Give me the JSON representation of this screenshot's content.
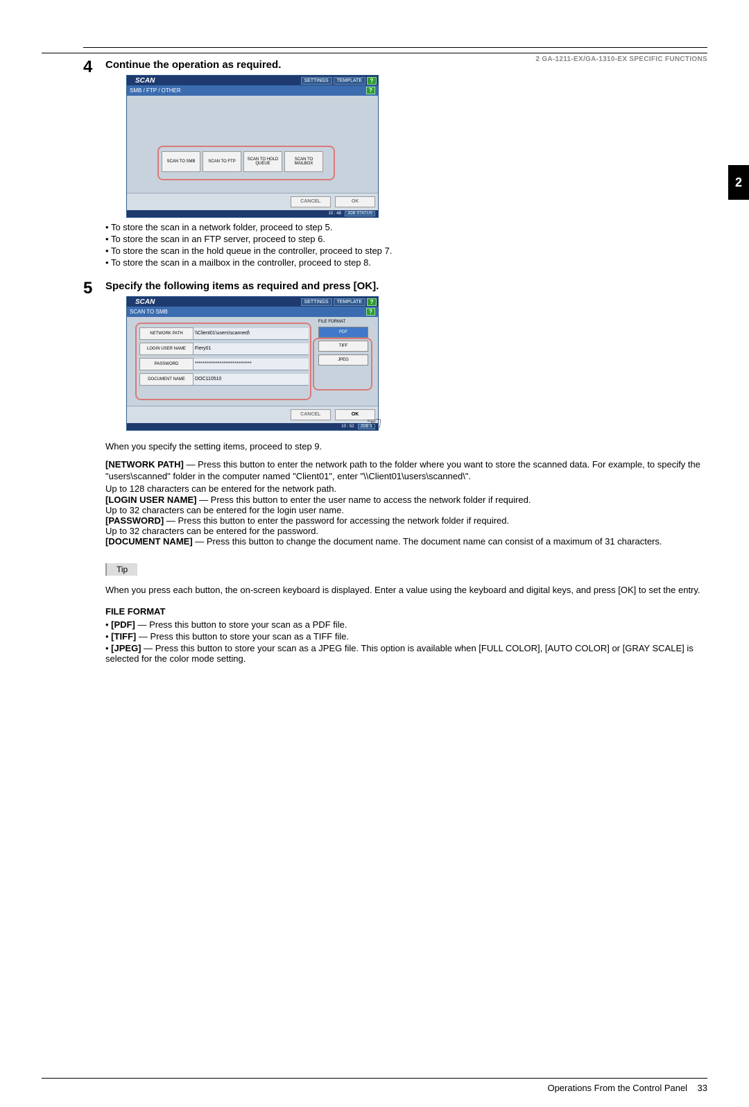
{
  "header": {
    "section": "2 GA-1211-EX/GA-1310-EX SPECIFIC FUNCTIONS",
    "tab": "2"
  },
  "step4": {
    "num": "4",
    "title": "Continue the operation as required.",
    "bullets": [
      "To store the scan in a network folder, proceed to step 5.",
      "To store the scan in an FTP server, proceed to step 6.",
      "To store the scan in the hold queue in the controller, proceed to step 7.",
      "To store the scan in a mailbox in the controller, proceed to step 8."
    ],
    "panel": {
      "title": "SCAN",
      "settings": "SETTINGS",
      "template": "TEMPLATE",
      "help": "?",
      "breadcrumb": "SMB / FTP / OTHER",
      "dest": [
        "SCAN TO SMB",
        "SCAN TO FTP",
        "SCAN TO HOLD QUEUE",
        "SCAN TO MAILBOX"
      ],
      "cancel": "CANCEL",
      "ok": "OK",
      "time": "10 : 48",
      "jobstatus": "JOB STATUS"
    }
  },
  "step5": {
    "num": "5",
    "title": "Specify the following items as required and press [OK].",
    "panel": {
      "title": "SCAN",
      "settings": "SETTINGS",
      "template": "TEMPLATE",
      "help": "?",
      "breadcrumb": "SCAN TO SMB",
      "rows": {
        "network_path_label": "NETWORK PATH",
        "network_path_value": "\\\\Client01\\users\\scanned\\",
        "login_label": "LOGIN USER NAME",
        "login_value": "Fiery01",
        "password_label": "PASSWORD",
        "password_value": "******************************",
        "docname_label": "DOCUMENT NAME",
        "docname_value": "DOC110510"
      },
      "ff_title": "FILE FORMAT",
      "ff": {
        "pdf": "PDF",
        "tiff": "TIFF",
        "jpeg": "JPEG"
      },
      "cancel": "CANCEL",
      "ok": "OK",
      "time": "10 : 52",
      "jobstatus": "JOB S"
    },
    "after": "When you specify the setting items, proceed to step 9.",
    "np_h": "[NETWORK PATH]",
    "np_t": " — Press this button to enter the network path to the folder where you want to store the scanned data. For example, to specify the \"users\\scanned\" folder in the computer named \"Client01\", enter \"\\\\Client01\\users\\scanned\\\".",
    "np_t2": "Up to 128 characters can be entered for the network path.",
    "lu_h": "[LOGIN USER NAME]",
    "lu_t": " — Press this button to enter the user name to access the network folder if required.",
    "lu_t2": "Up to 32 characters can be entered for the login user name.",
    "pw_h": "[PASSWORD]",
    "pw_t": " — Press this button to enter the password for accessing the network folder if required.",
    "pw_t2": "Up to 32 characters can be entered for the password.",
    "dn_h": "[DOCUMENT NAME]",
    "dn_t": " — Press this button to change the document name. The document name can consist of a maximum of 31 characters.",
    "tip_label": "Tip",
    "tip_text": "When you press each button, the on-screen keyboard is displayed. Enter a value using the keyboard and digital keys, and press [OK] to set the entry.",
    "ff_head": "FILE FORMAT",
    "ff_pdf_h": "[PDF]",
    "ff_pdf_t": " — Press this button to store your scan as a PDF file.",
    "ff_tiff_h": "[TIFF]",
    "ff_tiff_t": " — Press this button to store your scan as a TIFF file.",
    "ff_jpeg_h": "[JPEG]",
    "ff_jpeg_t": " — Press this button to store your scan as a JPEG file. This option is available when [FULL COLOR], [AUTO COLOR] or [GRAY SCALE] is selected for the color mode setting."
  },
  "footer": {
    "text": "Operations From the Control Panel",
    "page": "33"
  }
}
